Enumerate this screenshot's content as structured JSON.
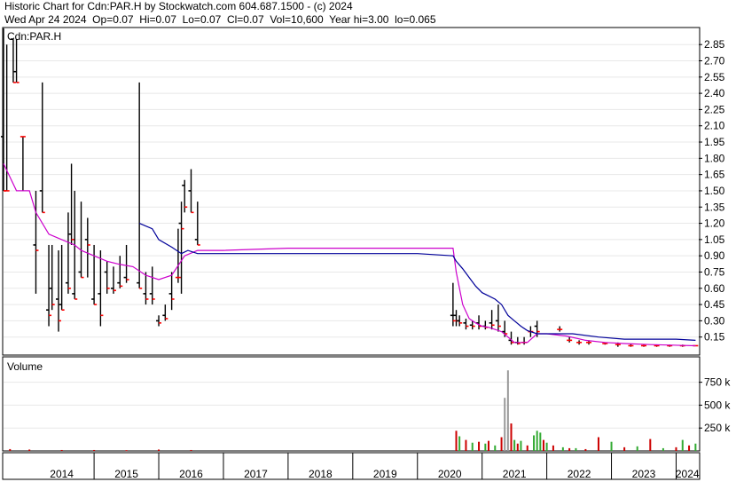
{
  "header": {
    "line1": "Historic Chart for Cdn:PAR.H by Stockwatch.com 604.687.1500 - (c) 2024",
    "line2": "Wed Apr 24 2024  Op=0.07  Hi=0.07  Lo=0.07  Cl=0.07  Vol=10,600  Year hi=3.00  lo=0.065"
  },
  "price_panel": {
    "symbol": "Cdn:PAR.H"
  },
  "volume_panel": {
    "title": "Volume"
  },
  "colors": {
    "up": "#ff0000",
    "down": "#000000",
    "ma_short": "#cc00cc",
    "ma_long": "#000099",
    "vol_up": "#33aa33",
    "vol_down": "#cc0000",
    "vol_other": "#999999"
  },
  "chart_data": [
    {
      "type": "line",
      "title": "Cdn:PAR.H",
      "x": [
        "2014",
        "2015",
        "2016",
        "2017",
        "2018",
        "2019",
        "2020",
        "2021",
        "2022",
        "2023",
        "2024"
      ],
      "y_ticks": [
        "2.85",
        "2.70",
        "2.55",
        "2.40",
        "2.25",
        "2.10",
        "1.95",
        "1.80",
        "1.65",
        "1.50",
        "1.35",
        "1.20",
        "1.05",
        "0.90",
        "0.75",
        "0.60",
        "0.45",
        "0.30",
        "0.15"
      ],
      "ylim": [
        0.0,
        2.95
      ],
      "series": [
        {
          "points": [
            [
              2013.6,
              1.75
            ],
            [
              2013.8,
              1.5
            ],
            [
              2014.0,
              1.5
            ],
            [
              2014.1,
              1.3
            ],
            [
              2014.3,
              1.1
            ],
            [
              2014.5,
              1.05
            ],
            [
              2014.7,
              1.0
            ],
            [
              2014.8,
              0.95
            ],
            [
              2015.0,
              0.9
            ],
            [
              2015.2,
              0.85
            ],
            [
              2015.4,
              0.82
            ],
            [
              2015.6,
              0.8
            ],
            [
              2015.8,
              0.72
            ],
            [
              2016.0,
              0.68
            ],
            [
              2016.2,
              0.72
            ],
            [
              2016.4,
              0.9
            ],
            [
              2016.6,
              0.95
            ],
            [
              2017.0,
              0.95
            ],
            [
              2018.0,
              0.97
            ],
            [
              2019.0,
              0.97
            ],
            [
              2020.0,
              0.97
            ],
            [
              2020.55,
              0.97
            ],
            [
              2020.6,
              0.75
            ],
            [
              2020.7,
              0.45
            ],
            [
              2020.8,
              0.32
            ],
            [
              2020.9,
              0.28
            ],
            [
              2021.0,
              0.25
            ],
            [
              2021.1,
              0.24
            ],
            [
              2021.3,
              0.2
            ],
            [
              2021.5,
              0.1
            ],
            [
              2021.7,
              0.1
            ],
            [
              2021.85,
              0.18
            ],
            [
              2022.0,
              0.18
            ],
            [
              2022.3,
              0.16
            ],
            [
              2022.6,
              0.12
            ],
            [
              2022.9,
              0.1
            ],
            [
              2023.2,
              0.09
            ],
            [
              2023.6,
              0.08
            ],
            [
              2024.3,
              0.07
            ]
          ]
        },
        {
          "points": [
            [
              2015.7,
              1.2
            ],
            [
              2015.9,
              1.15
            ],
            [
              2016.0,
              1.05
            ],
            [
              2016.2,
              0.98
            ],
            [
              2016.35,
              0.92
            ],
            [
              2016.45,
              0.95
            ],
            [
              2016.6,
              0.92
            ],
            [
              2017.0,
              0.92
            ],
            [
              2018.0,
              0.92
            ],
            [
              2019.0,
              0.92
            ],
            [
              2020.0,
              0.92
            ],
            [
              2020.55,
              0.9
            ],
            [
              2020.6,
              0.85
            ],
            [
              2020.7,
              0.78
            ],
            [
              2020.8,
              0.7
            ],
            [
              2020.9,
              0.62
            ],
            [
              2021.0,
              0.56
            ],
            [
              2021.1,
              0.53
            ],
            [
              2021.2,
              0.5
            ],
            [
              2021.3,
              0.45
            ],
            [
              2021.4,
              0.35
            ],
            [
              2021.5,
              0.3
            ],
            [
              2021.6,
              0.25
            ],
            [
              2021.7,
              0.21
            ],
            [
              2021.85,
              0.18
            ],
            [
              2022.0,
              0.18
            ],
            [
              2022.4,
              0.18
            ],
            [
              2022.8,
              0.15
            ],
            [
              2023.2,
              0.13
            ],
            [
              2023.6,
              0.13
            ],
            [
              2024.0,
              0.13
            ],
            [
              2024.3,
              0.12
            ]
          ]
        }
      ],
      "ohlc_bars": [
        [
          2013.6,
          3.0,
          1.5,
          2.0,
          1.5
        ],
        [
          2013.65,
          2.85,
          1.5,
          1.5,
          1.5
        ],
        [
          2013.75,
          2.9,
          2.5,
          2.9,
          2.5
        ],
        [
          2013.8,
          2.9,
          2.5,
          2.6,
          2.5
        ],
        [
          2013.9,
          2.0,
          1.5,
          2.0,
          2.0
        ],
        [
          2014.1,
          1.5,
          0.55,
          1.0,
          0.95
        ],
        [
          2014.2,
          2.5,
          1.3,
          1.5,
          1.3
        ],
        [
          2014.3,
          1.0,
          0.25,
          0.4,
          0.35
        ],
        [
          2014.35,
          1.0,
          0.4,
          0.6,
          0.45
        ],
        [
          2014.45,
          0.95,
          0.2,
          0.5,
          0.3
        ],
        [
          2014.5,
          1.0,
          0.4,
          0.45,
          0.4
        ],
        [
          2014.6,
          1.3,
          0.55,
          0.65,
          0.6
        ],
        [
          2014.65,
          1.75,
          1.0,
          1.1,
          1.05
        ],
        [
          2014.7,
          1.5,
          0.5,
          0.55,
          0.5
        ],
        [
          2014.8,
          1.4,
          0.7,
          0.75,
          0.7
        ],
        [
          2014.9,
          1.25,
          0.7,
          1.05,
          1.0
        ],
        [
          2015.0,
          1.0,
          0.45,
          0.5,
          0.45
        ],
        [
          2015.1,
          0.95,
          0.25,
          0.55,
          0.35
        ],
        [
          2015.2,
          0.85,
          0.55,
          0.75,
          0.6
        ],
        [
          2015.3,
          0.8,
          0.55,
          0.6,
          0.58
        ],
        [
          2015.4,
          0.9,
          0.6,
          0.65,
          0.62
        ],
        [
          2015.5,
          1.0,
          0.65,
          0.7,
          0.68
        ],
        [
          2015.7,
          2.5,
          0.6,
          0.65,
          0.6
        ],
        [
          2015.8,
          0.75,
          0.45,
          0.55,
          0.5
        ],
        [
          2015.9,
          0.8,
          0.45,
          0.55,
          0.5
        ],
        [
          2016.0,
          0.35,
          0.25,
          0.3,
          0.28
        ],
        [
          2016.1,
          0.45,
          0.3,
          0.35,
          0.32
        ],
        [
          2016.2,
          0.75,
          0.4,
          0.55,
          0.5
        ],
        [
          2016.3,
          1.15,
          0.65,
          0.7,
          0.7
        ],
        [
          2016.35,
          1.4,
          0.55,
          1.2,
          1.15
        ],
        [
          2016.4,
          1.6,
          1.3,
          1.55,
          1.35
        ],
        [
          2016.5,
          1.7,
          1.3,
          1.5,
          1.3
        ],
        [
          2016.6,
          1.4,
          1.0,
          1.05,
          1.0
        ],
        [
          2020.55,
          0.65,
          0.25,
          0.35,
          0.3
        ],
        [
          2020.6,
          0.4,
          0.25,
          0.35,
          0.3
        ],
        [
          2020.65,
          0.35,
          0.25,
          0.3,
          0.28
        ],
        [
          2020.75,
          0.32,
          0.22,
          0.28,
          0.25
        ],
        [
          2020.85,
          0.3,
          0.22,
          0.26,
          0.25
        ],
        [
          2020.95,
          0.35,
          0.22,
          0.28,
          0.25
        ],
        [
          2021.05,
          0.3,
          0.22,
          0.25,
          0.24
        ],
        [
          2021.15,
          0.4,
          0.22,
          0.28,
          0.26
        ],
        [
          2021.25,
          0.45,
          0.2,
          0.3,
          0.25
        ],
        [
          2021.35,
          0.3,
          0.15,
          0.2,
          0.18
        ],
        [
          2021.45,
          0.2,
          0.08,
          0.12,
          0.1
        ],
        [
          2021.55,
          0.15,
          0.08,
          0.1,
          0.09
        ],
        [
          2021.65,
          0.15,
          0.08,
          0.1,
          0.1
        ],
        [
          2021.75,
          0.25,
          0.15,
          0.2,
          0.2
        ],
        [
          2021.85,
          0.3,
          0.15,
          0.25,
          0.2
        ],
        [
          2022.2,
          0.25,
          0.2,
          0.22,
          0.22
        ],
        [
          2022.35,
          0.15,
          0.1,
          0.12,
          0.12
        ],
        [
          2022.5,
          0.12,
          0.08,
          0.1,
          0.1
        ],
        [
          2022.65,
          0.12,
          0.08,
          0.1,
          0.1
        ],
        [
          2022.9,
          0.1,
          0.08,
          0.09,
          0.09
        ],
        [
          2023.1,
          0.1,
          0.06,
          0.08,
          0.08
        ],
        [
          2023.3,
          0.09,
          0.06,
          0.07,
          0.07
        ],
        [
          2023.5,
          0.08,
          0.06,
          0.07,
          0.07
        ],
        [
          2023.7,
          0.08,
          0.06,
          0.07,
          0.07
        ],
        [
          2023.9,
          0.08,
          0.06,
          0.07,
          0.07
        ],
        [
          2024.1,
          0.08,
          0.06,
          0.07,
          0.07
        ],
        [
          2024.3,
          0.07,
          0.07,
          0.07,
          0.07
        ]
      ]
    },
    {
      "type": "bar",
      "title": "Volume",
      "y_ticks": [
        "750 k",
        "500 k",
        "250 k"
      ],
      "ylim": [
        0,
        950000
      ],
      "x": [
        2013.7,
        2014.0,
        2014.5,
        2015.0,
        2015.5,
        2016.0,
        2016.5,
        2020.6,
        2020.65,
        2020.75,
        2020.85,
        2020.95,
        2021.05,
        2021.1,
        2021.2,
        2021.3,
        2021.35,
        2021.4,
        2021.45,
        2021.5,
        2021.55,
        2021.6,
        2021.7,
        2021.8,
        2021.85,
        2021.9,
        2021.95,
        2022.0,
        2022.1,
        2022.25,
        2022.35,
        2022.45,
        2022.6,
        2022.8,
        2023.0,
        2023.2,
        2023.4,
        2023.6,
        2023.8,
        2024.0,
        2024.1,
        2024.2,
        2024.3
      ],
      "values": [
        20000,
        15000,
        10000,
        10000,
        8000,
        15000,
        10000,
        220000,
        160000,
        120000,
        90000,
        100000,
        80000,
        110000,
        60000,
        150000,
        580000,
        880000,
        300000,
        120000,
        80000,
        110000,
        60000,
        170000,
        220000,
        200000,
        120000,
        90000,
        60000,
        40000,
        30000,
        30000,
        20000,
        150000,
        100000,
        40000,
        50000,
        130000,
        30000,
        40000,
        120000,
        60000,
        80000
      ],
      "bar_colors": [
        "#cc0000",
        "#cc0000",
        "#cc0000",
        "#cc0000",
        "#cc0000",
        "#cc0000",
        "#cc0000",
        "#cc0000",
        "#33aa33",
        "#cc0000",
        "#33aa33",
        "#cc0000",
        "#33aa33",
        "#cc0000",
        "#33aa33",
        "#cc0000",
        "#999999",
        "#999999",
        "#cc0000",
        "#33aa33",
        "#cc0000",
        "#33aa33",
        "#cc0000",
        "#33aa33",
        "#33aa33",
        "#33aa33",
        "#cc0000",
        "#33aa33",
        "#cc0000",
        "#33aa33",
        "#cc0000",
        "#33aa33",
        "#cc0000",
        "#cc0000",
        "#33aa33",
        "#cc0000",
        "#33aa33",
        "#cc0000",
        "#33aa33",
        "#cc0000",
        "#33aa33",
        "#cc0000",
        "#33aa33"
      ]
    }
  ]
}
